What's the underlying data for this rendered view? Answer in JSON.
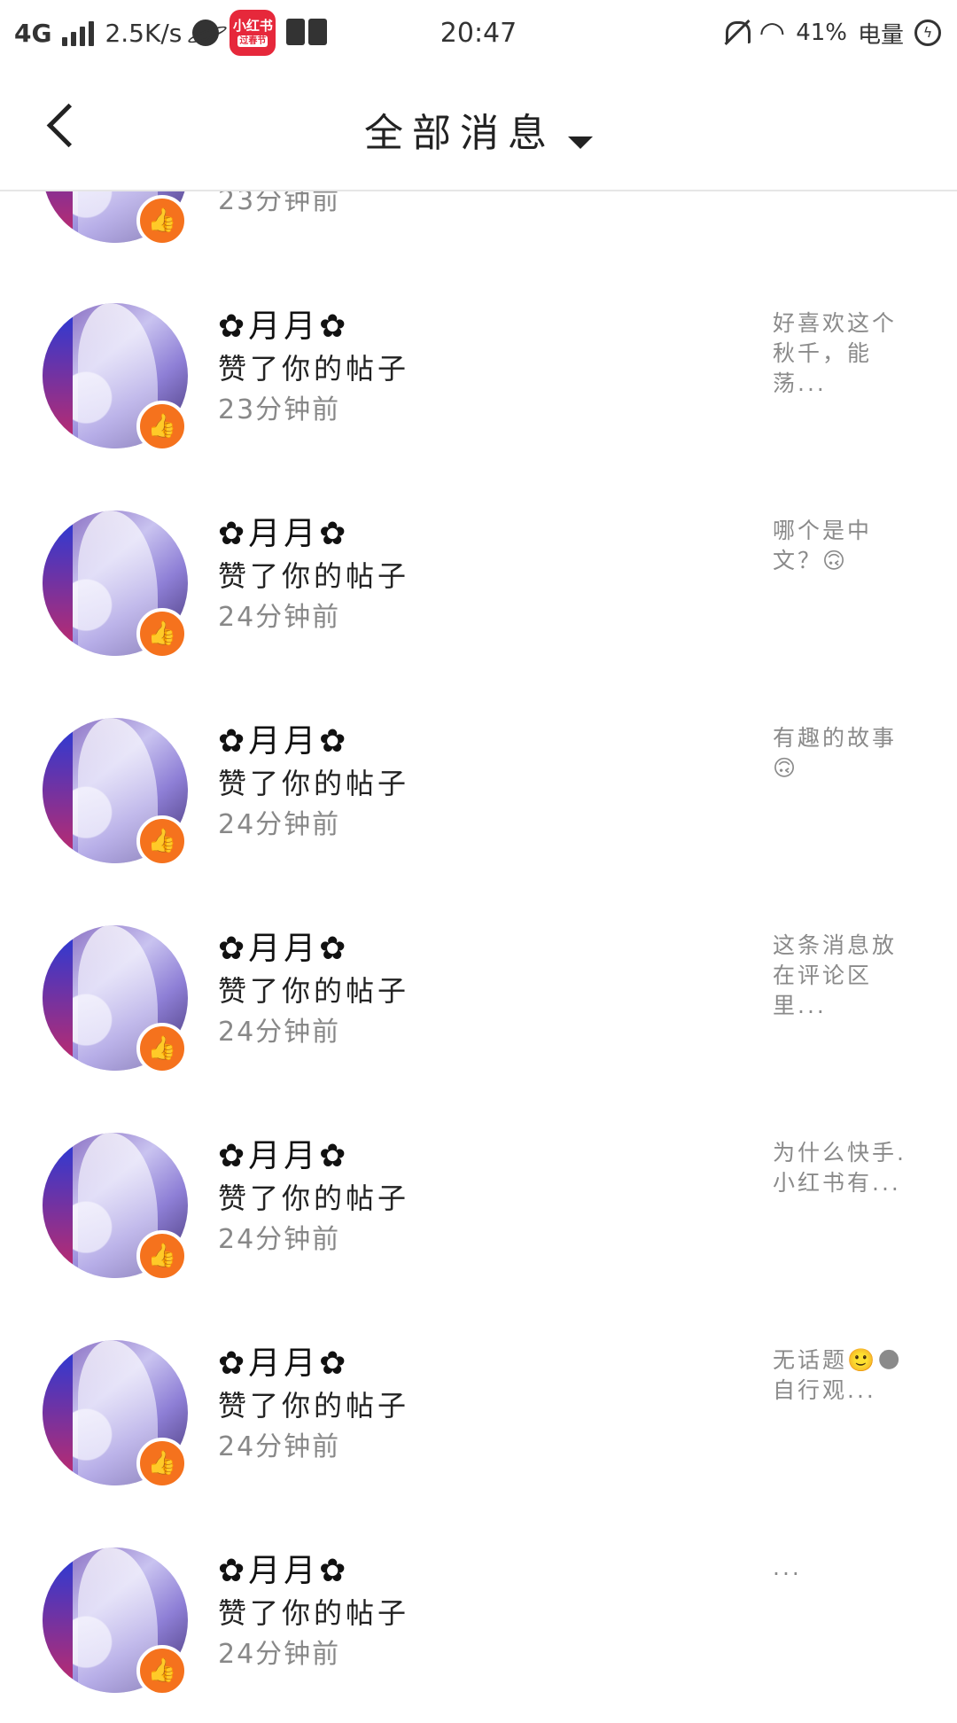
{
  "status_bar": {
    "network": "4G",
    "speed": "2.5K/s",
    "app_badge_top": "小红书",
    "app_badge_bottom": "过春节",
    "time": "20:47",
    "battery": "41%",
    "battery_label": "电量"
  },
  "header": {
    "title": "全部消息"
  },
  "top_partial_item": {
    "time": "23分钟前"
  },
  "items": [
    {
      "username": "✿月月✿",
      "action": "赞了你的帖子",
      "time": "23分钟前",
      "snippet": "好喜欢这个秋千，能荡..."
    },
    {
      "username": "✿月月✿",
      "action": "赞了你的帖子",
      "time": "24分钟前",
      "snippet": "哪个是中文？🙃"
    },
    {
      "username": "✿月月✿",
      "action": "赞了你的帖子",
      "time": "24分钟前",
      "snippet": "有趣的故事🙃"
    },
    {
      "username": "✿月月✿",
      "action": "赞了你的帖子",
      "time": "24分钟前",
      "snippet": "这条消息放在评论区里..."
    },
    {
      "username": "✿月月✿",
      "action": "赞了你的帖子",
      "time": "24分钟前",
      "snippet": "为什么快手.小红书有..."
    },
    {
      "username": "✿月月✿",
      "action": "赞了你的帖子",
      "time": "24分钟前",
      "snippet": "无话题🙂🌑自行观..."
    },
    {
      "username": "✿月月✿",
      "action": "赞了你的帖子",
      "time": "24分钟前",
      "snippet": "..."
    }
  ]
}
